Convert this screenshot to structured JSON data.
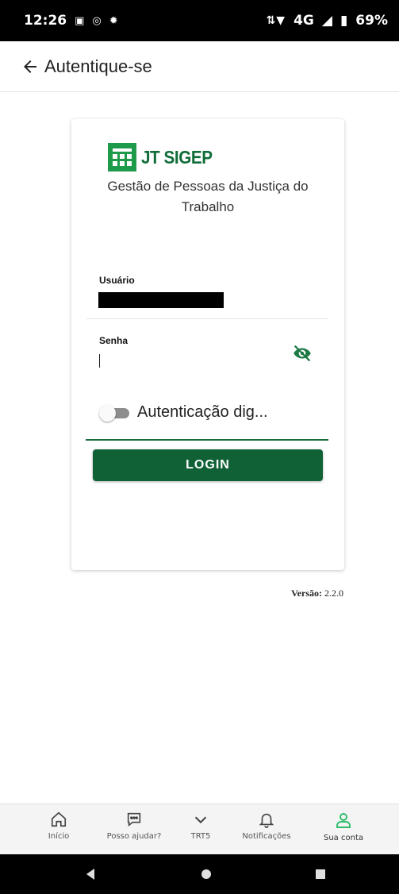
{
  "status_bar": {
    "time": "12:26",
    "left_icons": [
      "message-icon",
      "at-icon",
      "settings-icon"
    ],
    "signal_text": "4G",
    "battery": "69%"
  },
  "app_bar": {
    "title": "Autentique-se",
    "back_icon": "arrow-left-icon"
  },
  "card": {
    "logo_text": "JT SIGEP",
    "subtitle": "Gestão de Pessoas da Justiça do Trabalho",
    "user_label": "Usuário",
    "user_value": "",
    "password_label": "Senha",
    "password_value": "",
    "toggle_label": "Autenticação dig...",
    "toggle_on": false,
    "login_label": "LOGIN"
  },
  "version": {
    "label": "Versão:",
    "value": "2.2.0"
  },
  "bottom_nav": {
    "items": [
      {
        "label": "Início",
        "icon": "home-icon"
      },
      {
        "label": "Posso ajudar?",
        "icon": "chat-icon"
      },
      {
        "label": "TRT5",
        "icon": "chevron-down-icon"
      },
      {
        "label": "Notificações",
        "icon": "bell-icon"
      },
      {
        "label": "Sua conta",
        "icon": "person-icon"
      }
    ],
    "active_color": "#2ebd6b"
  },
  "colors": {
    "primary": "#106236",
    "accent": "#1e9a4b"
  }
}
